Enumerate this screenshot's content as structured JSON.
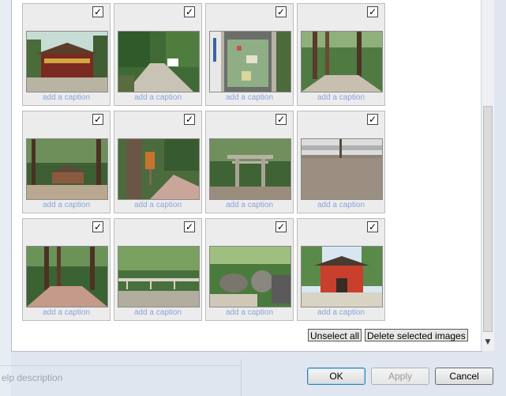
{
  "gallery": {
    "caption_placeholder": "add a caption",
    "items": [
      {
        "checked": "✓",
        "caption": "add a caption",
        "scene": "shrine-building"
      },
      {
        "checked": "✓",
        "caption": "add a caption",
        "scene": "forest-path"
      },
      {
        "checked": "✓",
        "caption": "add a caption",
        "scene": "map-sign"
      },
      {
        "checked": "✓",
        "caption": "add a caption",
        "scene": "tall-trees-path"
      },
      {
        "checked": "✓",
        "caption": "add a caption",
        "scene": "forest-hall"
      },
      {
        "checked": "✓",
        "caption": "add a caption",
        "scene": "tree-trunk-sign"
      },
      {
        "checked": "✓",
        "caption": "add a caption",
        "scene": "torii-gate"
      },
      {
        "checked": "✓",
        "caption": "add a caption",
        "scene": "fence-ground"
      },
      {
        "checked": "✓",
        "caption": "add a caption",
        "scene": "cedar-forest"
      },
      {
        "checked": "✓",
        "caption": "add a caption",
        "scene": "fenced-garden"
      },
      {
        "checked": "✓",
        "caption": "add a caption",
        "scene": "rock-garden"
      },
      {
        "checked": "✓",
        "caption": "add a caption",
        "scene": "red-gate"
      }
    ]
  },
  "actions": {
    "unselect_all": "Unselect all",
    "delete_selected": "Delete selected images"
  },
  "footer": {
    "help_description": "elp description",
    "ok": "OK",
    "apply": "Apply",
    "cancel": "Cancel"
  },
  "scroll": {
    "arrow_down": "▼"
  }
}
